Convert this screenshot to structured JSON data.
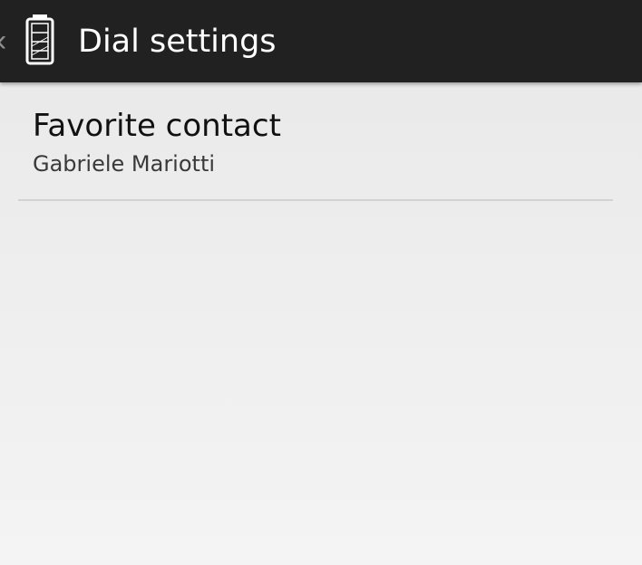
{
  "action_bar": {
    "title": "Dial settings",
    "up_icon": "chevron-left-icon",
    "app_icon": "battery-icon",
    "background": "#212121"
  },
  "preferences": [
    {
      "title": "Favorite contact",
      "summary": "Gabriele Mariotti"
    }
  ]
}
